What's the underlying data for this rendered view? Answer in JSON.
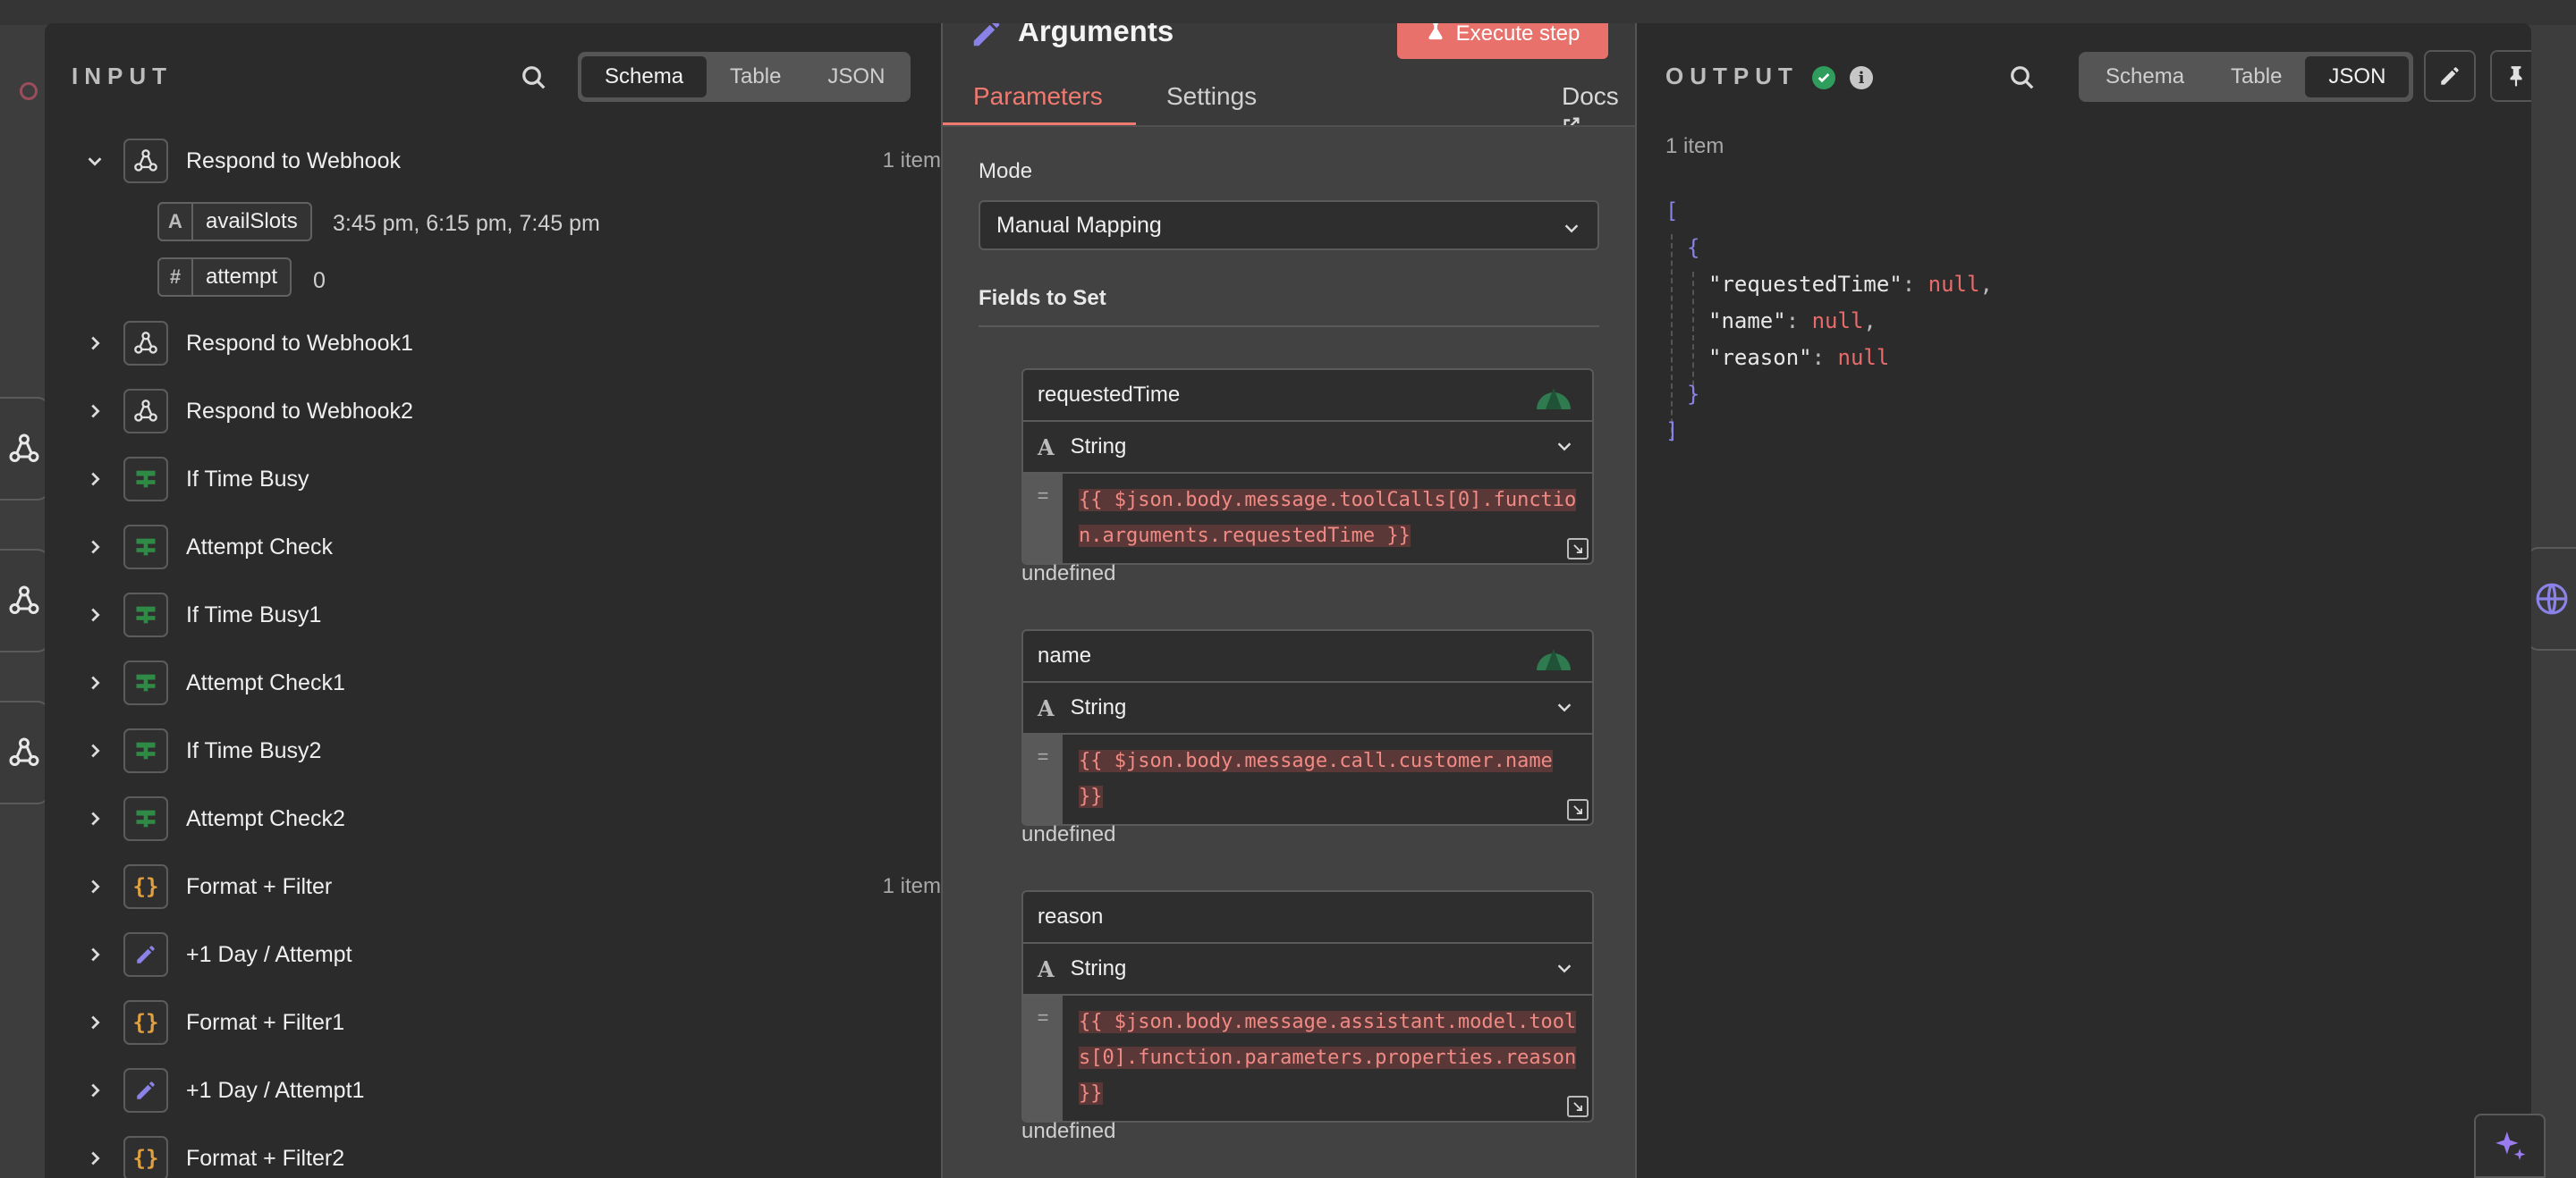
{
  "input": {
    "title": "INPUT",
    "tabs": [
      "Schema",
      "Table",
      "JSON"
    ],
    "active_tab": "Schema",
    "tree": [
      {
        "label": "Respond to Webhook",
        "icon": "webhook-icon",
        "count": "1 item",
        "expanded": true
      },
      {
        "label": "Respond to Webhook1",
        "icon": "webhook-icon",
        "count": ""
      },
      {
        "label": "Respond to Webhook2",
        "icon": "webhook-icon",
        "count": ""
      },
      {
        "label": "If Time Busy",
        "icon": "if-icon",
        "count": ""
      },
      {
        "label": "Attempt Check",
        "icon": "if-icon",
        "count": ""
      },
      {
        "label": "If Time Busy1",
        "icon": "if-icon",
        "count": ""
      },
      {
        "label": "Attempt Check1",
        "icon": "if-icon",
        "count": ""
      },
      {
        "label": "If Time Busy2",
        "icon": "if-icon",
        "count": ""
      },
      {
        "label": "Attempt Check2",
        "icon": "if-icon",
        "count": ""
      },
      {
        "label": "Format + Filter",
        "icon": "code-icon",
        "count": "1 item"
      },
      {
        "label": "+1 Day / Attempt",
        "icon": "pencil-icon",
        "count": ""
      },
      {
        "label": "Format + Filter1",
        "icon": "code-icon",
        "count": ""
      },
      {
        "label": "+1 Day / Attempt1",
        "icon": "pencil-icon",
        "count": ""
      },
      {
        "label": "Format + Filter2",
        "icon": "code-icon",
        "count": ""
      }
    ],
    "fields": [
      {
        "type": "A",
        "name": "availSlots",
        "value": "3:45 pm, 6:15 pm, 7:45 pm"
      },
      {
        "type": "#",
        "name": "attempt",
        "value": "0"
      }
    ]
  },
  "node": {
    "title": "Arguments",
    "execute_label": "Execute step",
    "tabs": [
      "Parameters",
      "Settings"
    ],
    "active_tab": "Parameters",
    "docs_label": "Docs",
    "mode_label": "Mode",
    "mode_value": "Manual Mapping",
    "fields_label": "Fields to Set",
    "fields": [
      {
        "name": "requestedTime",
        "type": "String",
        "expression": "{{ $json.body.message.toolCalls[0].function.arguments.requestedTime }}",
        "hint": "undefined"
      },
      {
        "name": "name",
        "type": "String",
        "expression": "{{ $json.body.message.call.customer.name }}",
        "hint": "undefined"
      },
      {
        "name": "reason",
        "type": "String",
        "expression": "{{ $json.body.message.assistant.model.tools[0].function.parameters.properties.reason }}",
        "hint": "undefined"
      }
    ]
  },
  "output": {
    "title": "OUTPUT",
    "tabs": [
      "Schema",
      "Table",
      "JSON"
    ],
    "active_tab": "JSON",
    "items_count": "1 item",
    "json_keys": [
      "\"requestedTime\"",
      "\"name\"",
      "\"reason\""
    ],
    "json_null": "null"
  },
  "colors": {
    "accent": "#f07a70",
    "execute_bg": "#e8716b",
    "success": "#2f9e5c",
    "bracket": "#8b82e8",
    "null": "#e86b6b"
  }
}
